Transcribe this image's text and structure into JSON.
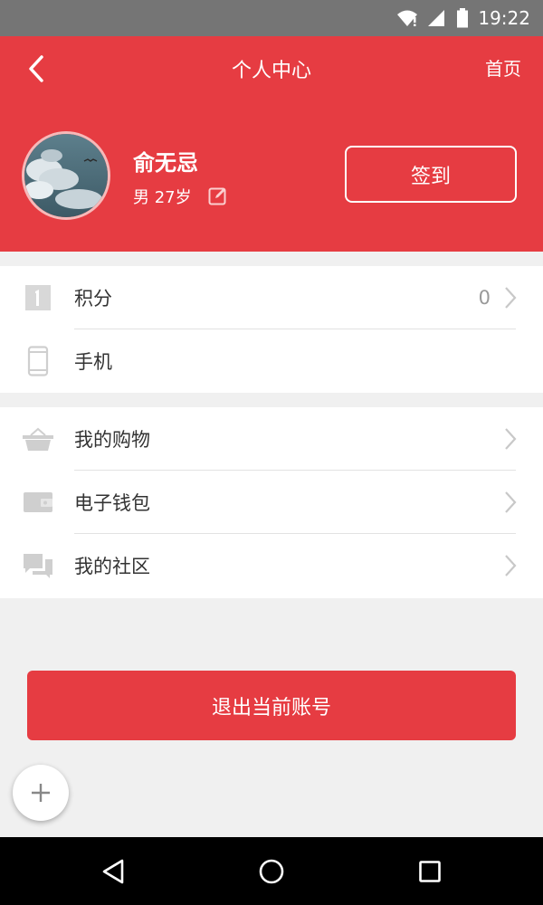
{
  "status_bar": {
    "time": "19:22"
  },
  "header": {
    "title": "个人中心",
    "home_label": "首页"
  },
  "profile": {
    "name": "俞无忌",
    "gender": "男",
    "age": "27岁",
    "signin_label": "签到"
  },
  "group1": [
    {
      "label": "积分",
      "value": "0",
      "icon": "points-icon",
      "chevron": true
    },
    {
      "label": "手机",
      "value": "",
      "icon": "phone-icon",
      "chevron": false
    }
  ],
  "group2": [
    {
      "label": "我的购物",
      "icon": "basket-icon",
      "chevron": true
    },
    {
      "label": "电子钱包",
      "icon": "wallet-icon",
      "chevron": true
    },
    {
      "label": "我的社区",
      "icon": "chat-icon",
      "chevron": true
    }
  ],
  "logout_label": "退出当前账号",
  "colors": {
    "accent": "#e63c42",
    "background": "#f0f0f0",
    "status_bar": "#757575"
  }
}
